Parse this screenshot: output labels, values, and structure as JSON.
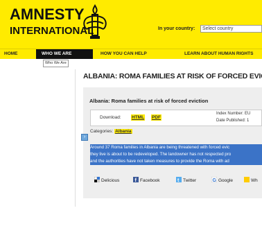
{
  "header": {
    "logo_line1": "AMNESTY",
    "logo_line2": "INTERNATIONAL",
    "country_label": "In your country:",
    "country_select": "Select country",
    "brand_color": "#ffeb00"
  },
  "nav": {
    "items": [
      {
        "label": "HOME"
      },
      {
        "label": "WHO WE ARE"
      },
      {
        "label": "HOW YOU CAN HELP"
      },
      {
        "label": "LEARN ABOUT HUMAN RIGHTS"
      }
    ],
    "active_index": 1,
    "tooltip": "Who We Are"
  },
  "main": {
    "page_title": "ALBANIA: ROMA FAMILIES AT RISK OF FORCED EVIC",
    "panel_heading": "Albania: Roma families at risk of forced eviction",
    "download_label": "Download:",
    "download_html": "HTML",
    "download_pdf": "PDF",
    "index_number": "Index Number: EU",
    "date_published": "Date Published: 1",
    "categories_label": "Categories:",
    "category": "Albania",
    "summary_lines": [
      "Around 37 Roma families in Albania are being threatened with forced evic",
      "they live is about to be redeveloped. The landowner has not respected pro",
      "and the authorities have not taken measures to provide the Roma with ad"
    ]
  },
  "share": {
    "delicious": "Delicious",
    "facebook": "Facebook",
    "twitter": "Twitter",
    "google": "Google",
    "more": "Wh"
  }
}
